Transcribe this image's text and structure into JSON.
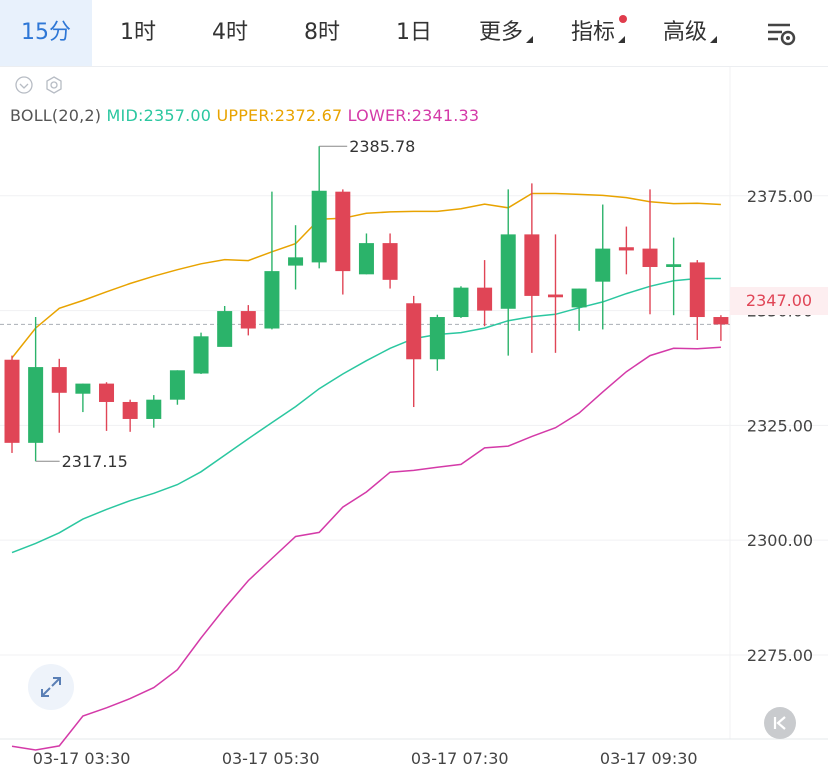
{
  "tabs": [
    {
      "label": "15分",
      "active": true
    },
    {
      "label": "1时"
    },
    {
      "label": "4时"
    },
    {
      "label": "8时"
    },
    {
      "label": "1日"
    },
    {
      "label": "更多",
      "dropdown": true
    },
    {
      "label": "指标",
      "dropdown": true,
      "badge": true
    },
    {
      "label": "高级",
      "dropdown": true
    }
  ],
  "icons": {
    "settings": "chart-settings-icon",
    "expand": "expand-arrows-icon",
    "collapse": "collapse-left-icon",
    "eye": "eye-icon",
    "gear": "gear-icon"
  },
  "legend": {
    "boll": "BOLL(20,2)",
    "mid": "MID:2357.00",
    "upper": "UPPER:2372.67",
    "lower": "LOWER:2341.33"
  },
  "current_price_label": "2347.00",
  "colors": {
    "up": "#2bb36a",
    "down": "#e04556",
    "mid": "#2bc7a0",
    "upper": "#e8a300",
    "lower": "#d43aa8",
    "active_tab": "#2e77d6"
  },
  "chart_data": {
    "type": "candlestick",
    "indicator": "BOLL(20,2)",
    "y_ticks": [
      2375.0,
      2350.0,
      2325.0,
      2300.0,
      2275.0
    ],
    "y_tick_labels": [
      "2375.00",
      "2350.00",
      "2325.00",
      "2300.00",
      "2275.00"
    ],
    "ylim": [
      2256.7,
      2392.6
    ],
    "x_labels": [
      "03-17 03:30",
      "03-17 05:30",
      "03-17 07:30",
      "03-17 09:30"
    ],
    "x_label_index": [
      1,
      9,
      17,
      25
    ],
    "current_price": 2347.0,
    "annotations": {
      "high": "2385.78",
      "low": "2317.15"
    },
    "candles": [
      {
        "o": 2339.3,
        "h": 2340.2,
        "l": 2319.0,
        "c": 2321.2
      },
      {
        "o": 2321.2,
        "h": 2348.6,
        "l": 2317.2,
        "c": 2337.7
      },
      {
        "o": 2337.7,
        "h": 2339.5,
        "l": 2323.4,
        "c": 2332.1
      },
      {
        "o": 2331.9,
        "h": 2334.1,
        "l": 2327.9,
        "c": 2334.1
      },
      {
        "o": 2334.1,
        "h": 2334.4,
        "l": 2323.8,
        "c": 2330.1
      },
      {
        "o": 2330.1,
        "h": 2330.6,
        "l": 2323.6,
        "c": 2326.4
      },
      {
        "o": 2326.4,
        "h": 2331.6,
        "l": 2324.5,
        "c": 2330.6
      },
      {
        "o": 2330.6,
        "h": 2337.0,
        "l": 2329.5,
        "c": 2337.0
      },
      {
        "o": 2336.3,
        "h": 2345.2,
        "l": 2336.2,
        "c": 2344.4
      },
      {
        "o": 2342.1,
        "h": 2351.0,
        "l": 2343.4,
        "c": 2349.9
      },
      {
        "o": 2349.9,
        "h": 2351.2,
        "l": 2344.6,
        "c": 2346.1
      },
      {
        "o": 2346.1,
        "h": 2375.9,
        "l": 2345.9,
        "c": 2358.6
      },
      {
        "o": 2359.8,
        "h": 2368.6,
        "l": 2354.6,
        "c": 2361.6
      },
      {
        "o": 2360.5,
        "h": 2385.8,
        "l": 2359.2,
        "c": 2376.1
      },
      {
        "o": 2375.9,
        "h": 2376.4,
        "l": 2353.5,
        "c": 2358.6
      },
      {
        "o": 2357.9,
        "h": 2366.8,
        "l": 2357.9,
        "c": 2364.7
      },
      {
        "o": 2364.7,
        "h": 2366.8,
        "l": 2354.8,
        "c": 2356.7
      },
      {
        "o": 2351.6,
        "h": 2353.2,
        "l": 2329.0,
        "c": 2339.4
      },
      {
        "o": 2339.4,
        "h": 2349.1,
        "l": 2336.9,
        "c": 2348.6
      },
      {
        "o": 2348.6,
        "h": 2355.3,
        "l": 2348.4,
        "c": 2355.0
      },
      {
        "o": 2355.0,
        "h": 2361.0,
        "l": 2346.6,
        "c": 2350.0
      },
      {
        "o": 2350.4,
        "h": 2376.4,
        "l": 2340.2,
        "c": 2366.6
      },
      {
        "o": 2366.6,
        "h": 2377.7,
        "l": 2340.8,
        "c": 2353.2
      },
      {
        "o": 2353.5,
        "h": 2366.6,
        "l": 2340.8,
        "c": 2352.9
      },
      {
        "o": 2350.7,
        "h": 2354.8,
        "l": 2345.6,
        "c": 2354.8
      },
      {
        "o": 2356.3,
        "h": 2373.1,
        "l": 2345.9,
        "c": 2363.5
      },
      {
        "o": 2363.8,
        "h": 2368.3,
        "l": 2357.9,
        "c": 2363.1
      },
      {
        "o": 2363.5,
        "h": 2376.4,
        "l": 2349.2,
        "c": 2359.5
      },
      {
        "o": 2359.5,
        "h": 2365.9,
        "l": 2349.0,
        "c": 2360.1
      },
      {
        "o": 2360.5,
        "h": 2361.0,
        "l": 2343.6,
        "c": 2348.6
      },
      {
        "o": 2348.6,
        "h": 2349.0,
        "l": 2343.4,
        "c": 2347.0
      }
    ],
    "series": [
      {
        "name": "UPPER",
        "values": [
          2339.7,
          2346.2,
          2350.5,
          2352.2,
          2354.1,
          2355.9,
          2357.5,
          2358.9,
          2360.2,
          2361.1,
          2360.9,
          2362.8,
          2364.6,
          2369.9,
          2370.1,
          2371.2,
          2371.5,
          2371.6,
          2371.6,
          2372.2,
          2373.2,
          2372.4,
          2375.5,
          2375.5,
          2375.3,
          2375.1,
          2374.6,
          2373.7,
          2373.3,
          2373.4,
          2373.1
        ]
      },
      {
        "name": "MID",
        "values": [
          2297.3,
          2299.3,
          2301.6,
          2304.6,
          2306.7,
          2308.6,
          2310.2,
          2312.1,
          2314.9,
          2318.5,
          2322.1,
          2325.6,
          2329.1,
          2333.0,
          2336.2,
          2339.1,
          2341.8,
          2343.9,
          2344.8,
          2345.2,
          2346.2,
          2347.8,
          2348.7,
          2349.2,
          2350.6,
          2351.9,
          2353.7,
          2355.3,
          2356.5,
          2357.0,
          2357.0
        ]
      },
      {
        "name": "LOWER",
        "values": [
          2255.1,
          2254.3,
          2255.2,
          2261.7,
          2263.5,
          2265.5,
          2267.9,
          2271.8,
          2278.7,
          2285.2,
          2291.2,
          2296.0,
          2300.8,
          2301.7,
          2307.2,
          2310.5,
          2314.8,
          2315.2,
          2315.9,
          2316.5,
          2320.1,
          2320.5,
          2322.6,
          2324.5,
          2327.7,
          2332.3,
          2336.7,
          2340.2,
          2341.8,
          2341.7,
          2342.0
        ]
      }
    ]
  }
}
